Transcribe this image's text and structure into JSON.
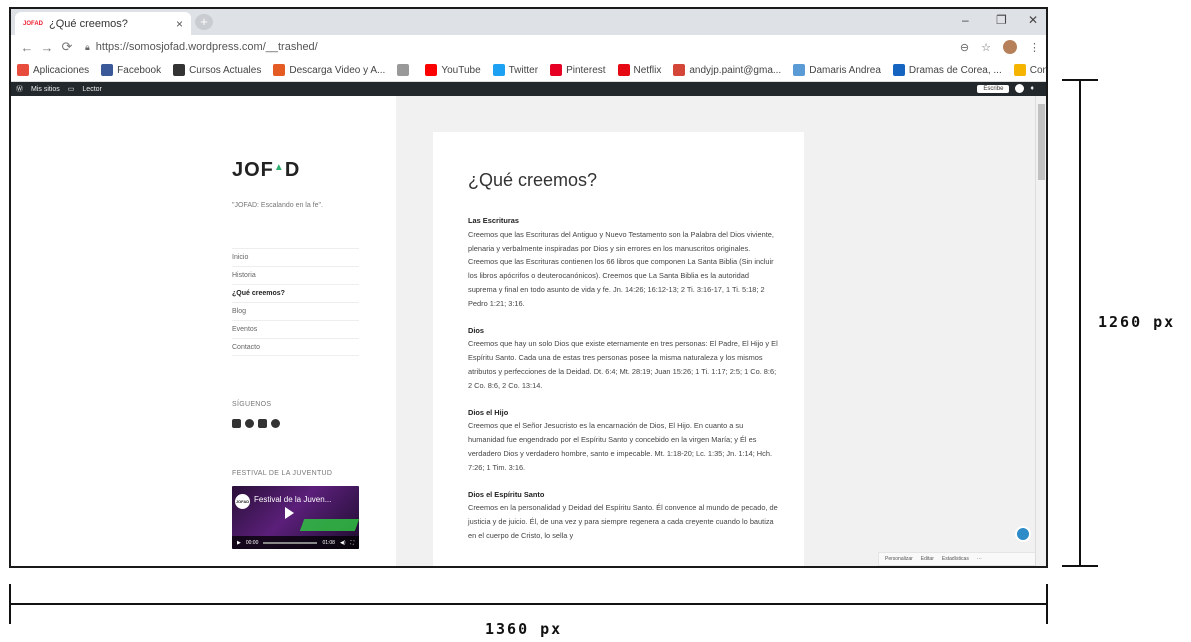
{
  "tab": {
    "favicon": "JOFAD",
    "title": "¿Qué creemos?",
    "close": "×",
    "new_tab": "+"
  },
  "window_controls": {
    "minimize": "–",
    "maximize": "❐",
    "close": "✕"
  },
  "address": {
    "url": "https://somosjofad.wordpress.com/__trashed/"
  },
  "bookmarks": [
    {
      "label": "Aplicaciones",
      "icon": "apps-grid-icon",
      "color": "#e84c3d"
    },
    {
      "label": "Facebook",
      "icon": "facebook-icon",
      "color": "#3b5998"
    },
    {
      "label": "Cursos Actuales",
      "icon": "cursos-icon",
      "color": "#333333"
    },
    {
      "label": "Descarga Video y A...",
      "icon": "download-icon",
      "color": "#e45b23"
    },
    {
      "label": "",
      "icon": "page-icon",
      "color": "#999999"
    },
    {
      "label": "YouTube",
      "icon": "youtube-icon",
      "color": "#ff0000"
    },
    {
      "label": "Twitter",
      "icon": "twitter-icon",
      "color": "#1da1f2"
    },
    {
      "label": "Pinterest",
      "icon": "pinterest-icon",
      "color": "#e60023"
    },
    {
      "label": "Netflix",
      "icon": "netflix-icon",
      "color": "#e50914"
    },
    {
      "label": "andyjp.paint@gma...",
      "icon": "gmail-icon",
      "color": "#d44638"
    },
    {
      "label": "Damaris Andrea",
      "icon": "profile-icon",
      "color": "#5b9bd5"
    },
    {
      "label": "Dramas de Corea, ...",
      "icon": "r-icon",
      "color": "#1565c0"
    },
    {
      "label": "Convertidor de Vid...",
      "icon": "folder-icon",
      "color": "#f4b400"
    }
  ],
  "adminbar": {
    "mis_sitios": "Mis sitios",
    "lector": "Lector",
    "escribe": "Escribe"
  },
  "sidebar": {
    "logo": "JOF▲D",
    "tagline": "\"JOFAD: Escalando en la fe\".",
    "menu": [
      "Inicio",
      "Historia",
      "¿Qué creemos?",
      "Blog",
      "Eventos",
      "Contacto"
    ],
    "siguenos": "SÍGUENOS",
    "festival": "FESTIVAL DE LA JUVENTUD",
    "video": {
      "title": "Festival de la Juven...",
      "time_current": "00:00",
      "time_total": "01:08"
    }
  },
  "article": {
    "title": "¿Qué creemos?",
    "sections": [
      {
        "heading": "Las Escrituras",
        "text": "Creemos que las Escrituras del Antiguo y Nuevo Testamento son la Palabra del Dios viviente, plenaria y verbalmente inspiradas por Dios y sin errores en los manuscritos originales. Creemos que las Escrituras contienen los 66 libros que componen La Santa Biblia (Sin incluir los libros apócrifos o deuterocanónicos). Creemos que La Santa Biblia es la autoridad suprema y final en todo asunto de vida y fe. Jn. 14:26; 16:12-13; 2 Ti. 3:16-17, 1 Ti. 5:18; 2 Pedro 1:21; 3:16."
      },
      {
        "heading": "Dios",
        "text": "Creemos que hay un solo Dios que existe eternamente en tres personas: El Padre, El Hijo y El Espíritu Santo. Cada una de estas tres personas posee la misma naturaleza y los mismos atributos y perfecciones de la Deidad. Dt. 6:4; Mt. 28:19; Juan 15:26; 1 Ti. 1:17; 2:5; 1 Co. 8:6; 2 Co. 8:6, 2 Co. 13:14."
      },
      {
        "heading": "Dios el Hijo",
        "text": "Creemos que el Señor Jesucristo es la encarnación de Dios, El Hijo. En cuanto a su humanidad fue engendrado por el Espíritu Santo y concebido en la virgen María; y Él es verdadero Dios y verdadero hombre, santo e impecable. Mt. 1:18-20; Lc. 1:35; Jn. 1:14; Hch. 7:26; 1 Tim. 3:16."
      },
      {
        "heading": "Dios el Espíritu Santo",
        "text": "Creemos en la personalidad y Deidad del Espíritu Santo. Él convence al mundo de pecado, de justicia y de juicio. Él, de una vez y para siempre regenera a cada creyente cuando lo bautiza en el cuerpo de Cristo, lo sella y"
      }
    ]
  },
  "footer_bar": {
    "personalizar": "Personalizar",
    "editar": "Editar",
    "estadisticas": "Estadísticas",
    "more": "···"
  },
  "dimensions": {
    "height": "1260 px",
    "width": "1360 px"
  }
}
